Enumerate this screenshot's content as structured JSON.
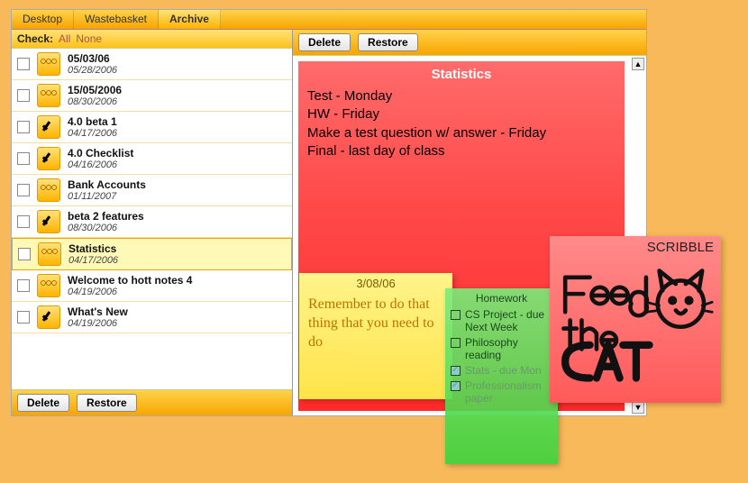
{
  "tabs": [
    "Desktop",
    "Wastebasket",
    "Archive"
  ],
  "active_tab": 2,
  "check_label": "Check:",
  "check_all": "All",
  "check_none": "None",
  "buttons": {
    "delete": "Delete",
    "restore": "Restore"
  },
  "list": [
    {
      "title": "05/03/06",
      "date": "05/28/2006",
      "icon": "wavy",
      "selected": false
    },
    {
      "title": "15/05/2006",
      "date": "08/30/2006",
      "icon": "wavy",
      "selected": false
    },
    {
      "title": "4.0 beta 1",
      "date": "04/17/2006",
      "icon": "check",
      "selected": false
    },
    {
      "title": "4.0 Checklist",
      "date": "04/16/2006",
      "icon": "check",
      "selected": false
    },
    {
      "title": "Bank Accounts",
      "date": "01/11/2007",
      "icon": "wavy",
      "selected": false
    },
    {
      "title": "beta 2 features",
      "date": "08/30/2006",
      "icon": "check",
      "selected": false
    },
    {
      "title": "Statistics",
      "date": "04/17/2006",
      "icon": "wavy",
      "selected": true
    },
    {
      "title": "Welcome to hott notes 4",
      "date": "04/19/2006",
      "icon": "wavy",
      "selected": false
    },
    {
      "title": "What's New",
      "date": "04/19/2006",
      "icon": "check",
      "selected": false
    }
  ],
  "preview": {
    "title": "Statistics",
    "lines": [
      "Test - Monday",
      "HW - Friday",
      "Make a test question w/ answer - Friday",
      "Final - last day of class"
    ]
  },
  "sticky_yellow": {
    "title": "3/08/06",
    "body": "Remember to do that thing that you need to do"
  },
  "sticky_green": {
    "title": "Homework",
    "items": [
      {
        "text": "CS Project - due Next Week",
        "done": false
      },
      {
        "text": "Philosophy reading",
        "done": false
      },
      {
        "text": "Stats - due Mon",
        "done": true
      },
      {
        "text": "Professionalism paper",
        "done": true
      }
    ]
  },
  "sticky_pink": {
    "title": "SCRIBBLE",
    "scribble_text": "Feed the CAT"
  }
}
